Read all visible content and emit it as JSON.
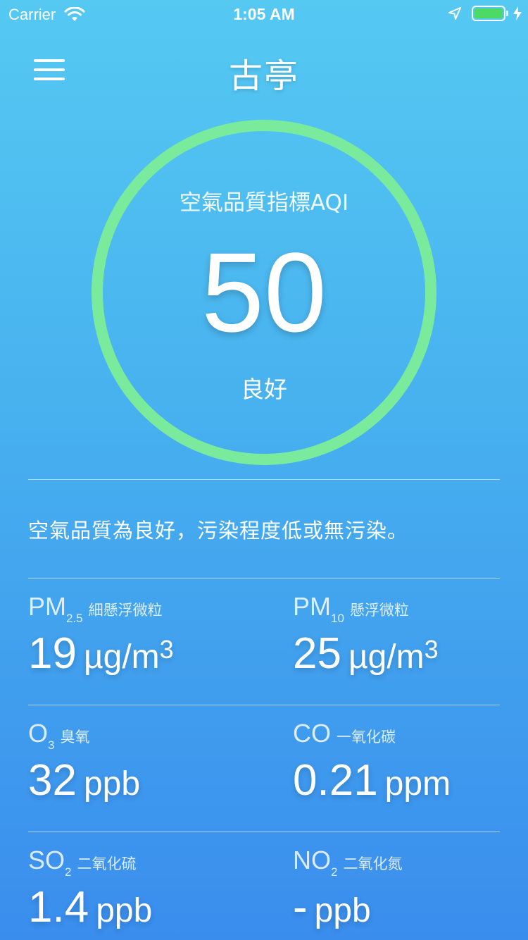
{
  "status_bar": {
    "carrier": "Carrier",
    "time": "1:05 AM",
    "battery_color": "#4cd964"
  },
  "header": {
    "title": "古亭",
    "menu_icon": "hamburger-menu-icon"
  },
  "aqi": {
    "label": "空氣品質指標AQI",
    "value": "50",
    "status": "良好",
    "ring_color": "#7aeb9c"
  },
  "description": "空氣品質為良好，污染程度低或無污染。",
  "pollutants": [
    {
      "symbol": "PM",
      "subscript": "2.5",
      "name": "細懸浮微粒",
      "value": "19",
      "unit": "µg/m",
      "unit_sup": "3"
    },
    {
      "symbol": "PM",
      "subscript": "10",
      "name": "懸浮微粒",
      "value": "25",
      "unit": "µg/m",
      "unit_sup": "3"
    },
    {
      "symbol": "O",
      "subscript": "3",
      "name": "臭氧",
      "value": "32",
      "unit": "ppb",
      "unit_sup": ""
    },
    {
      "symbol": "CO",
      "subscript": "",
      "name": "一氧化碳",
      "value": "0.21",
      "unit": "ppm",
      "unit_sup": ""
    },
    {
      "symbol": "SO",
      "subscript": "2",
      "name": "二氧化硫",
      "value": "1.4",
      "unit": "ppb",
      "unit_sup": ""
    },
    {
      "symbol": "NO",
      "subscript": "2",
      "name": "二氧化氮",
      "value": "-",
      "unit": "ppb",
      "unit_sup": ""
    }
  ],
  "colors": {
    "background_top": "#55c9f2",
    "background_bottom": "#3a8ded"
  }
}
